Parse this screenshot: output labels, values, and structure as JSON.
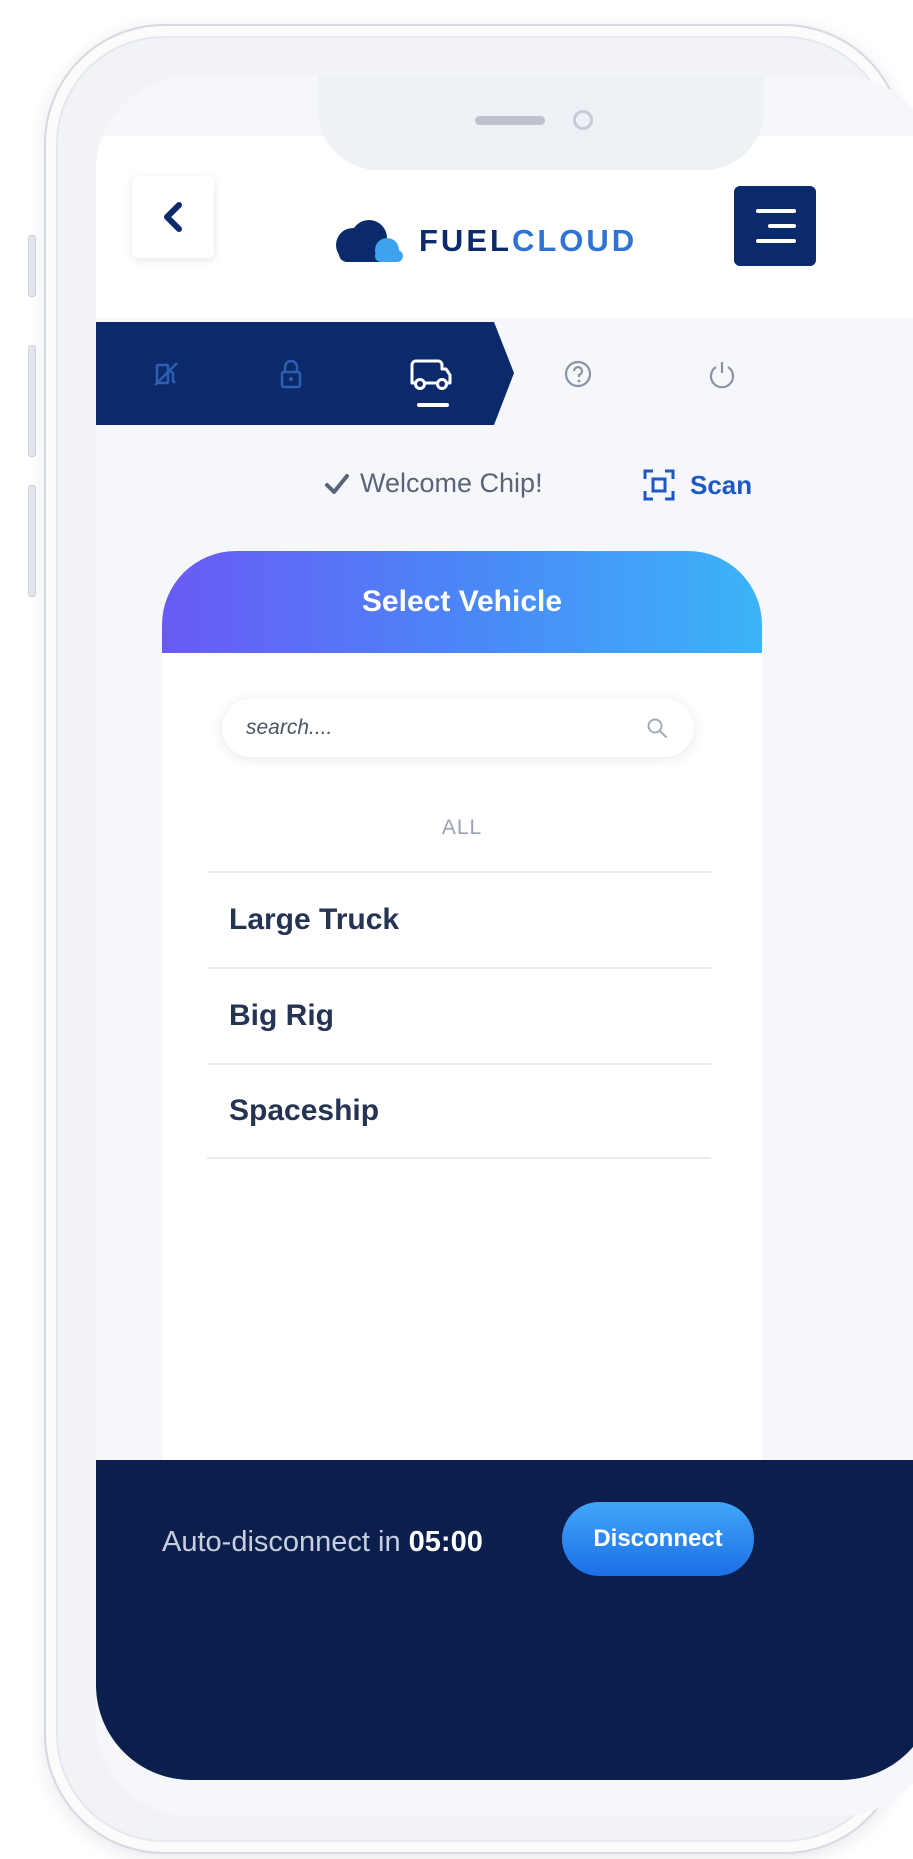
{
  "header": {
    "back_icon": "chevron-left-icon",
    "logo_fuel": "FUEL",
    "logo_cloud": "CLOUD",
    "menu_icon": "hamburger-menu-icon"
  },
  "tabs": [
    {
      "icon": "fuel-pump-icon",
      "active": false
    },
    {
      "icon": "lock-icon",
      "active": false
    },
    {
      "icon": "truck-icon",
      "active": true
    },
    {
      "icon": "help-icon",
      "active": false
    },
    {
      "icon": "power-icon",
      "active": false
    }
  ],
  "status": {
    "welcome": "Welcome Chip!",
    "scan_label": "Scan"
  },
  "card": {
    "title": "Select Vehicle",
    "search_placeholder": "search....",
    "filter": "ALL",
    "vehicles": [
      "Large Truck",
      "Big Rig",
      "Spaceship"
    ]
  },
  "footer": {
    "auto_disconnect_label": "Auto-disconnect in",
    "countdown": "05:00",
    "disconnect_label": "Disconnect"
  },
  "colors": {
    "navy": "#0b2a6b",
    "footer": "#0c1f4c",
    "accent_blue": "#2f73d6",
    "gradient_start": "#6a5af5",
    "gradient_end": "#3cb4f8"
  }
}
